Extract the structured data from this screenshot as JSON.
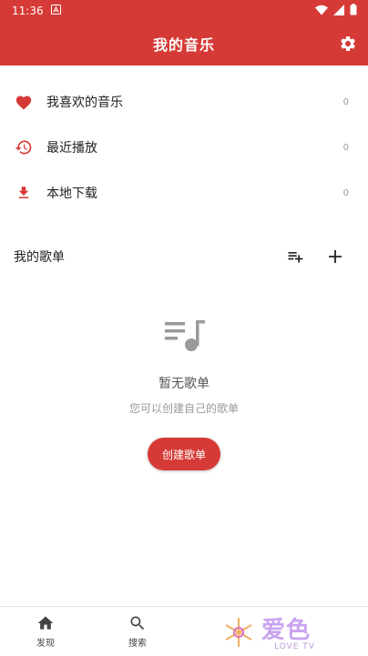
{
  "status_bar": {
    "time": "11:36",
    "notification_icon": "a-icon"
  },
  "app_bar": {
    "title": "我的音乐",
    "action_icon": "gear-icon"
  },
  "library": [
    {
      "label": "我喜欢的音乐",
      "count": "0",
      "icon": "heart-icon"
    },
    {
      "label": "最近播放",
      "count": "0",
      "icon": "history-icon"
    },
    {
      "label": "本地下载",
      "count": "0",
      "icon": "download-icon"
    }
  ],
  "playlists": {
    "title": "我的歌单",
    "empty_title": "暂无歌单",
    "empty_subtitle": "您可以创建自己的歌单",
    "create_label": "创建歌单"
  },
  "bottom_nav": [
    {
      "label": "发现",
      "icon": "home-icon"
    },
    {
      "label": "搜索",
      "icon": "search-icon"
    }
  ],
  "watermark": {
    "text": "爱色",
    "sub": "LOVE TV"
  },
  "colors": {
    "accent": "#d63a36",
    "muted": "#999999"
  }
}
